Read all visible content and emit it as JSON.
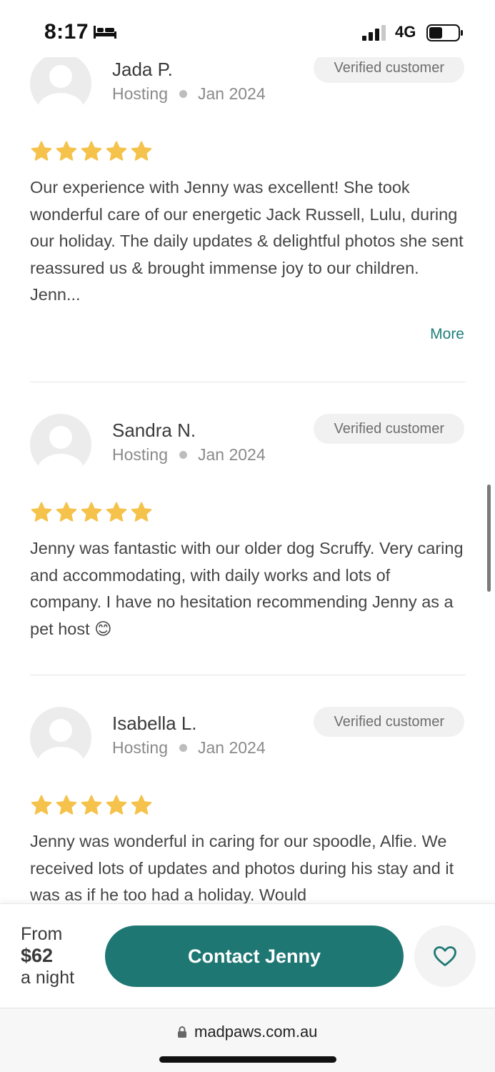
{
  "status_bar": {
    "time": "8:17",
    "network": "4G",
    "signal_bars": 3,
    "battery_level": 0.45
  },
  "reviews": [
    {
      "name": "Jada P.",
      "service": "Hosting",
      "date": "Jan 2024",
      "badge": "Verified customer",
      "rating": 5,
      "text": "Our experience with Jenny was excellent! She took wonderful care of our energetic Jack Russell, Lulu, during our holiday. The daily updates & delightful photos she sent reassured us & brought immense joy to our children. Jenn...",
      "more_label": "More"
    },
    {
      "name": "Sandra N.",
      "service": "Hosting",
      "date": "Jan 2024",
      "badge": "Verified customer",
      "rating": 5,
      "text": "Jenny was fantastic with our older dog Scruffy. Very caring and accommodating, with daily works and lots of company. I have no hesitation recommending Jenny as a pet host 😊"
    },
    {
      "name": "Isabella L.",
      "service": "Hosting",
      "date": "Jan 2024",
      "badge": "Verified customer",
      "rating": 5,
      "text": "Jenny was wonderful in caring for our spoodle, Alfie. We received lots of updates and photos during his stay and it was as if he too had a holiday. Would"
    }
  ],
  "booking": {
    "from_label": "From",
    "price": "$62",
    "unit_label": "a night",
    "contact_label": "Contact Jenny"
  },
  "browser": {
    "url": "madpaws.com.au"
  },
  "colors": {
    "accent": "#1f7773",
    "star": "#f5c24b",
    "link": "#1f7f7a"
  },
  "icons": {
    "favorite": "heart-outline-icon",
    "secure": "lock-icon",
    "avatar": "user-placeholder-icon",
    "rating": "star-icon"
  }
}
